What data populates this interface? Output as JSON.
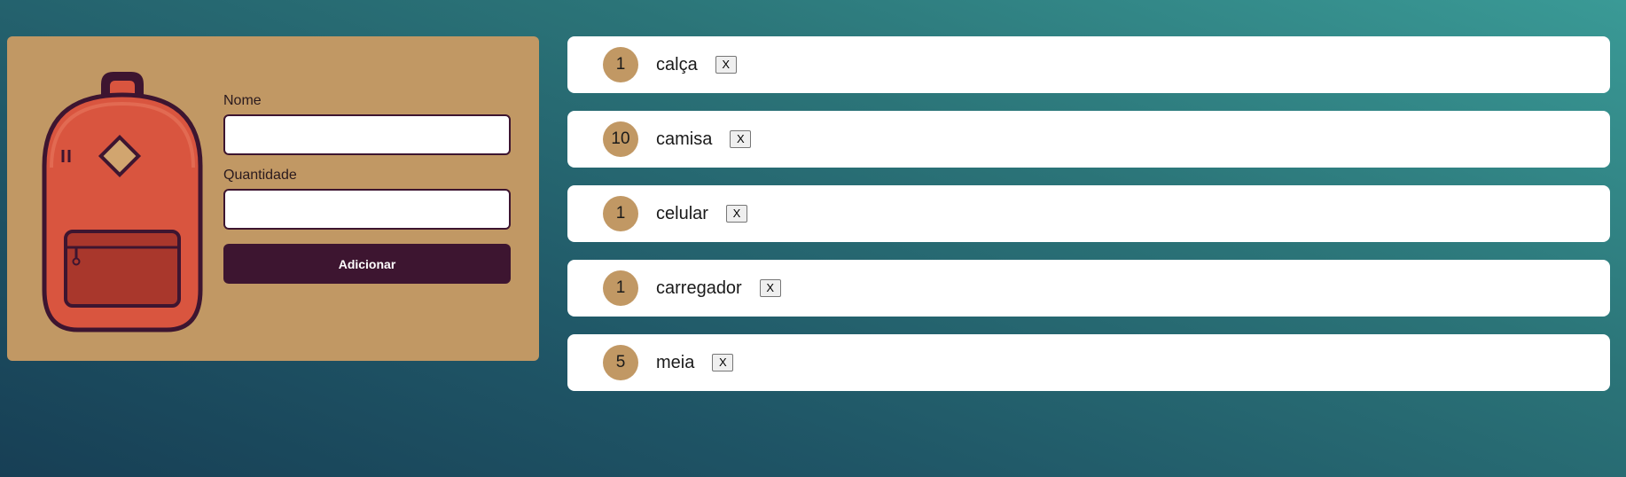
{
  "form": {
    "nome_label": "Nome",
    "nome_value": "",
    "quantidade_label": "Quantidade",
    "quantidade_value": "",
    "submit_label": "Adicionar"
  },
  "colors": {
    "panel": "#c19864",
    "button": "#3d1530",
    "backpack_body": "#d9553f",
    "backpack_outline": "#3d1530"
  },
  "items": [
    {
      "quantity": "1",
      "name": "calça",
      "remove_label": "X"
    },
    {
      "quantity": "10",
      "name": "camisa",
      "remove_label": "X"
    },
    {
      "quantity": "1",
      "name": "celular",
      "remove_label": "X"
    },
    {
      "quantity": "1",
      "name": "carregador",
      "remove_label": "X"
    },
    {
      "quantity": "5",
      "name": "meia",
      "remove_label": "X"
    }
  ]
}
